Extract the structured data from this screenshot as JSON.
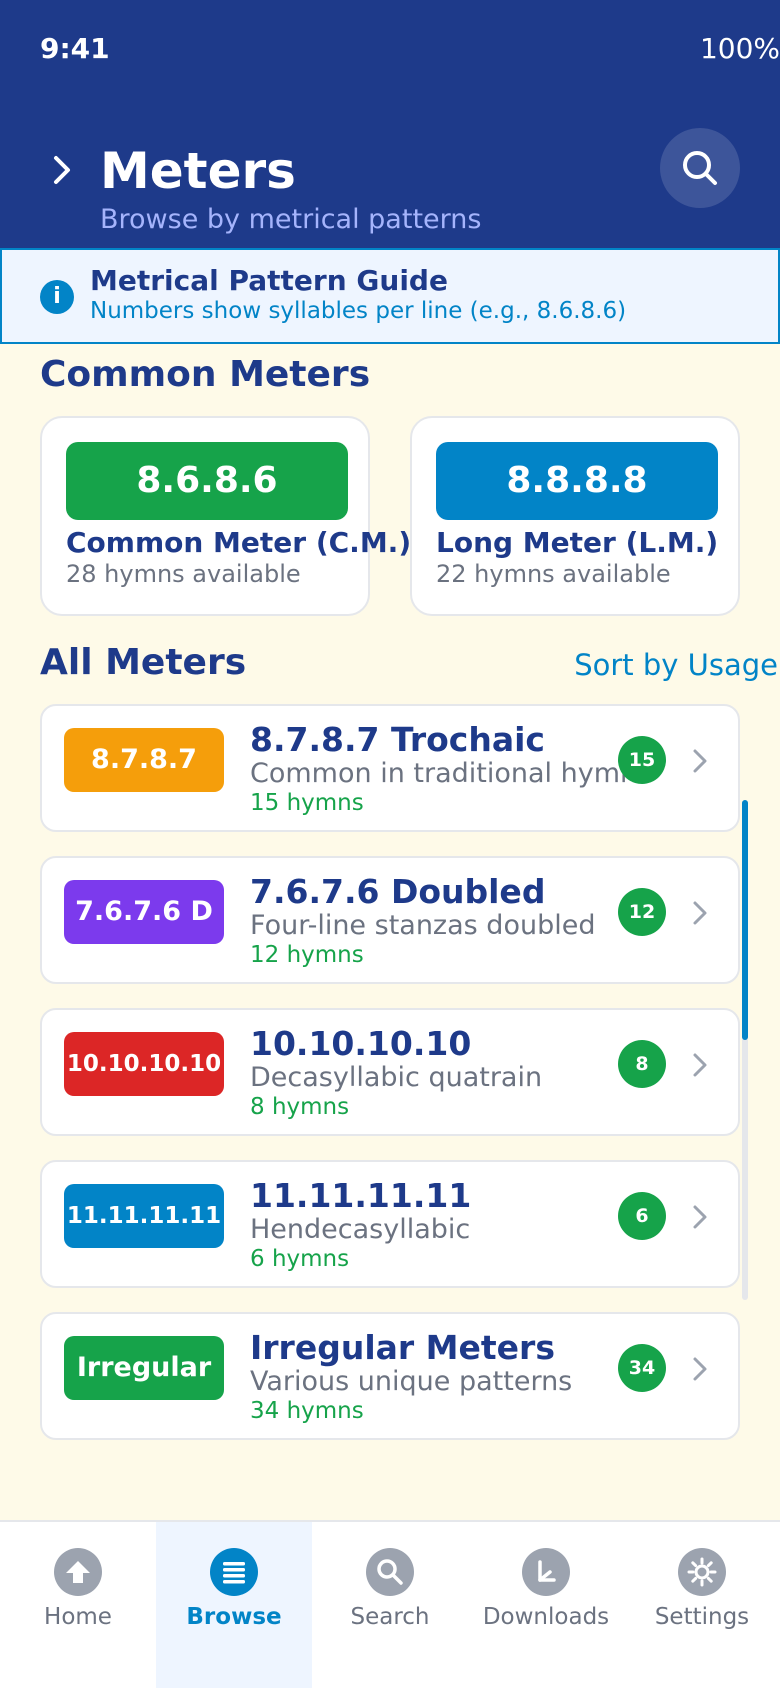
{
  "status": {
    "time": "9:41",
    "battery": "100%"
  },
  "header": {
    "title": "Meters",
    "subtitle": "Browse by metrical patterns"
  },
  "guide": {
    "title": "Metrical Pattern Guide",
    "description": "Numbers show syllables per line (e.g., 8.6.8.6)"
  },
  "common": {
    "section_title": "Common Meters",
    "cards": [
      {
        "badge": "8.6.8.6",
        "name": "Common Meter (C.M.)",
        "count": "28 hymns available",
        "color": "#16a34a"
      },
      {
        "badge": "8.8.8.8",
        "name": "Long Meter (L.M.)",
        "count": "22 hymns available",
        "color": "#0284c7"
      }
    ]
  },
  "all": {
    "section_title": "All Meters",
    "sort_label": "Sort by Usage",
    "rows": [
      {
        "badge": "8.7.8.7",
        "name": "8.7.8.7 Trochaic",
        "desc": "Common in traditional hymns",
        "count": "15 hymns",
        "pill": "15",
        "color": "#f59e0b"
      },
      {
        "badge": "7.6.7.6 D",
        "name": "7.6.7.6 Doubled",
        "desc": "Four-line stanzas doubled",
        "count": "12 hymns",
        "pill": "12",
        "color": "#7c3aed"
      },
      {
        "badge": "10.10.10.10",
        "name": "10.10.10.10",
        "desc": "Decasyllabic quatrain",
        "count": "8 hymns",
        "pill": "8",
        "color": "#dc2626"
      },
      {
        "badge": "11.11.11.11",
        "name": "11.11.11.11",
        "desc": "Hendecasyllabic",
        "count": "6 hymns",
        "pill": "6",
        "color": "#0284c7"
      },
      {
        "badge": "Irregular",
        "name": "Irregular Meters",
        "desc": "Various unique patterns",
        "count": "34 hymns",
        "pill": "34",
        "color": "#16a34a"
      }
    ]
  },
  "nav": {
    "items": [
      {
        "label": "Home",
        "icon": "home-icon"
      },
      {
        "label": "Browse",
        "icon": "list-icon"
      },
      {
        "label": "Search",
        "icon": "search-icon"
      },
      {
        "label": "Downloads",
        "icon": "download-icon"
      },
      {
        "label": "Settings",
        "icon": "gear-icon"
      }
    ],
    "active": "Browse"
  }
}
